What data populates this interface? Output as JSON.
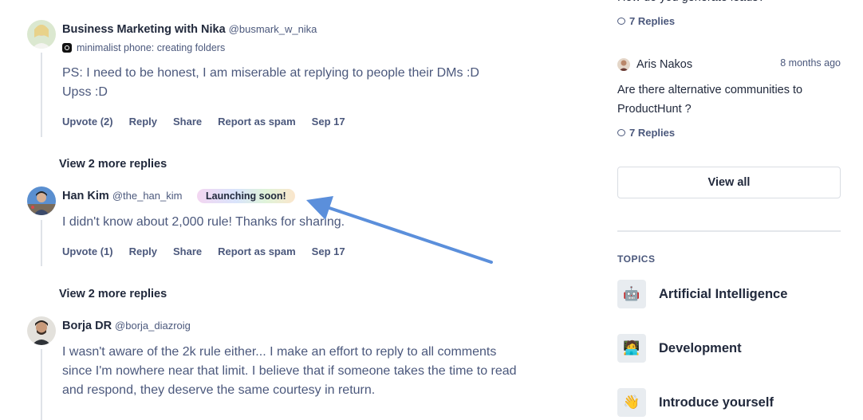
{
  "comments": [
    {
      "name": "Business Marketing with Nika",
      "handle": "@busmark_w_nika",
      "status": "minimalist phone: creating folders",
      "text": "PS: I need to be honest, I am miserable at replying to people their DMs :D Upss :D",
      "actions": {
        "upvote": "Upvote",
        "upvote_count": "(2)",
        "reply": "Reply",
        "share": "Share",
        "report": "Report as spam",
        "date": "Sep 17"
      }
    },
    {
      "name": "Han Kim",
      "handle": "@the_han_kim",
      "badge": "Launching soon!",
      "text": "I didn't know about 2,000 rule! Thanks for sharing.",
      "actions": {
        "upvote": "Upvote",
        "upvote_count": "(1)",
        "reply": "Reply",
        "share": "Share",
        "report": "Report as spam",
        "date": "Sep 17"
      }
    },
    {
      "name": "Borja DR",
      "handle": "@borja_diazroig",
      "text": "I wasn't aware of the 2k rule either... I make an effort to reply to all comments since I'm nowhere near that limit. I believe that if someone takes the time to read and respond, they deserve the same courtesy in return."
    }
  ],
  "view_more": [
    "View 2 more replies",
    "View 2 more replies"
  ],
  "sidebar": {
    "cut_title": "How do you generate leads?",
    "cut_replies": "7 Replies",
    "discussion": {
      "author": "Aris Nakos",
      "time": "8 months ago",
      "title": "Are there alternative communities to ProductHunt ?",
      "replies": "7 Replies"
    },
    "view_all": "View all",
    "topics_heading": "TOPICS",
    "topics": [
      {
        "label": "Artificial Intelligence",
        "icon": "robot-icon",
        "glyph": "🤖"
      },
      {
        "label": "Development",
        "icon": "developer-icon",
        "glyph": "🧑‍💻"
      },
      {
        "label": "Introduce yourself",
        "icon": "waving-hand-icon",
        "glyph": "👋"
      }
    ]
  },
  "colors": {
    "accent_arrow": "#5b8fdb",
    "text_primary": "#21293c",
    "text_secondary": "#4b587c"
  }
}
